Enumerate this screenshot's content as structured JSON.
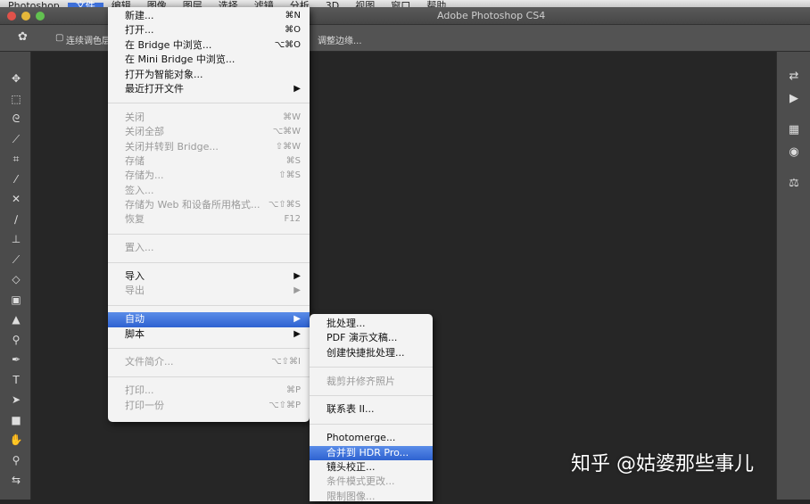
{
  "menubar": {
    "items": [
      "Photoshop",
      "文件",
      "编辑",
      "图像",
      "图层",
      "选择",
      "滤镜",
      "分析",
      "3D",
      "视图",
      "窗口",
      "帮助"
    ],
    "active": 1
  },
  "window": {
    "title": "Adobe Photoshop CS4"
  },
  "options": {
    "mode_label": "连续调色层",
    "refine_edge": "调整边缘..."
  },
  "tools": [
    "move",
    "marquee",
    "lasso",
    "quick-select",
    "crop",
    "eyedropper",
    "healing",
    "brush",
    "stamp",
    "history-brush",
    "eraser",
    "gradient",
    "blur",
    "dodge",
    "pen",
    "type",
    "path-select",
    "shape",
    "hand",
    "zoom",
    "swap-colors"
  ],
  "dock": [
    "layers",
    "play",
    "swatches",
    "adjustments",
    "styles"
  ],
  "file_menu": [
    {
      "label": "新建...",
      "sc": "⌘N",
      "state": "on"
    },
    {
      "label": "打开...",
      "sc": "⌘O",
      "state": "on"
    },
    {
      "label": "在 Bridge 中浏览...",
      "sc": "⌥⌘O",
      "state": "on"
    },
    {
      "label": "在 Mini Bridge 中浏览...",
      "sc": "",
      "state": "on"
    },
    {
      "label": "打开为智能对象...",
      "sc": "",
      "state": "on"
    },
    {
      "label": "最近打开文件",
      "sc": "▶",
      "state": "on"
    },
    {
      "sep": true
    },
    {
      "label": "关闭",
      "sc": "⌘W",
      "state": "dis"
    },
    {
      "label": "关闭全部",
      "sc": "⌥⌘W",
      "state": "dis"
    },
    {
      "label": "关闭并转到 Bridge...",
      "sc": "⇧⌘W",
      "state": "dis"
    },
    {
      "label": "存储",
      "sc": "⌘S",
      "state": "dis"
    },
    {
      "label": "存储为...",
      "sc": "⇧⌘S",
      "state": "dis"
    },
    {
      "label": "签入...",
      "sc": "",
      "state": "dis"
    },
    {
      "label": "存储为 Web 和设备所用格式...",
      "sc": "⌥⇧⌘S",
      "state": "dis"
    },
    {
      "label": "恢复",
      "sc": "F12",
      "state": "dis"
    },
    {
      "sep": true
    },
    {
      "label": "置入...",
      "sc": "",
      "state": "dis"
    },
    {
      "sep": true
    },
    {
      "label": "导入",
      "sc": "▶",
      "state": "on"
    },
    {
      "label": "导出",
      "sc": "▶",
      "state": "dis"
    },
    {
      "sep": true
    },
    {
      "label": "自动",
      "sc": "▶",
      "state": "hl"
    },
    {
      "label": "脚本",
      "sc": "▶",
      "state": "on"
    },
    {
      "sep": true
    },
    {
      "label": "文件简介...",
      "sc": "⌥⇧⌘I",
      "state": "dis"
    },
    {
      "sep": true
    },
    {
      "label": "打印...",
      "sc": "⌘P",
      "state": "dis"
    },
    {
      "label": "打印一份",
      "sc": "⌥⇧⌘P",
      "state": "dis"
    }
  ],
  "auto_submenu": [
    {
      "label": "批处理...",
      "state": "on"
    },
    {
      "label": "PDF 演示文稿...",
      "state": "on"
    },
    {
      "label": "创建快捷批处理...",
      "state": "on"
    },
    {
      "sep": true
    },
    {
      "label": "裁剪并修齐照片",
      "state": "dis"
    },
    {
      "sep": true
    },
    {
      "label": "联系表 II...",
      "state": "on"
    },
    {
      "sep": true
    },
    {
      "label": "Photomerge...",
      "state": "on"
    },
    {
      "label": "合并到 HDR Pro...",
      "state": "hl"
    },
    {
      "label": "镜头校正...",
      "state": "on"
    },
    {
      "label": "条件模式更改...",
      "state": "dis"
    },
    {
      "label": "限制图像...",
      "state": "dis"
    }
  ],
  "watermark": "知乎 @姑婆那些事儿"
}
